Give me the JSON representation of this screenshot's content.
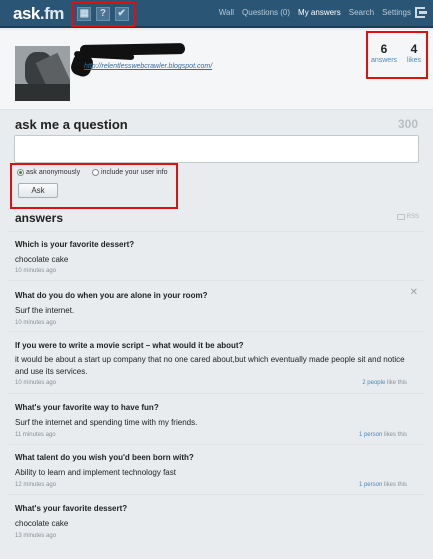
{
  "topbar": {
    "logo_main": "ask",
    "logo_suffix": ".fm",
    "icons": [
      "grid-icon",
      "question-icon",
      "check-icon"
    ],
    "icon_glyphs": [
      "▦",
      "?",
      "✔"
    ],
    "nav": [
      {
        "label": "Wall",
        "active": false
      },
      {
        "label": "Questions (0)",
        "active": false
      },
      {
        "label": "My answers",
        "active": true
      },
      {
        "label": "Search",
        "active": false
      },
      {
        "label": "Settings",
        "active": false
      }
    ]
  },
  "profile": {
    "blog_link": "http://relentlesswebcrawler.blogspot.com/",
    "answers_count": "6",
    "answers_label": "answers",
    "likes_count": "4",
    "likes_label": "likes"
  },
  "ask": {
    "title": "ask me a question",
    "char_count": "300",
    "option_anonymous": "ask anonymously",
    "option_userinfo": "include your user info",
    "button_label": "Ask"
  },
  "answers": {
    "title": "answers",
    "rss_label": "RSS",
    "items": [
      {
        "question": "Which is your favorite dessert?",
        "answer": "chocolate cake",
        "time": "10 minutes ago",
        "likes_count": "",
        "likes_text": ""
      },
      {
        "question": "What do you do when you are alone in your room?",
        "answer": "Surf the internet.",
        "time": "10 minutes ago",
        "likes_count": "",
        "likes_text": ""
      },
      {
        "question": "If you were to write a movie script – what would it be about?",
        "answer": "it would be about a start up company that no one cared about,but which eventually made people sit and notice and use its services.",
        "time": "10 minutes ago",
        "likes_count": "2 people",
        "likes_text": " like this"
      },
      {
        "question": "What's your favorite way to have fun?",
        "answer": "Surf the internet and spending time with my friends.",
        "time": "11 minutes ago",
        "likes_count": "1 person",
        "likes_text": " likes this"
      },
      {
        "question": "What talent do you wish you'd been born with?",
        "answer": "Ability to learn and implement technology fast",
        "time": "12 minutes ago",
        "likes_count": "1 person",
        "likes_text": " likes this"
      },
      {
        "question": "What's your favorite dessert?",
        "answer": "chocolate cake",
        "time": "13 minutes ago",
        "likes_count": "",
        "likes_text": ""
      }
    ]
  }
}
